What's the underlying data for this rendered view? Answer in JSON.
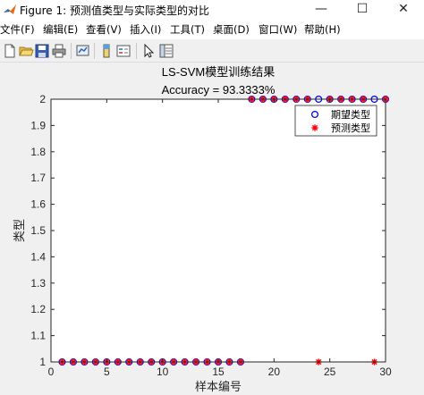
{
  "window": {
    "title": "Figure 1: 预测值类型与实际类型的对比",
    "minimize_glyph": "—",
    "maximize_glyph": "☐",
    "close_glyph": "✕"
  },
  "menu": {
    "items": [
      {
        "label": "文件(F)"
      },
      {
        "label": "编辑(E)"
      },
      {
        "label": "查看(V)"
      },
      {
        "label": "插入(I)"
      },
      {
        "label": "工具(T)"
      },
      {
        "label": "桌面(D)"
      },
      {
        "label": "窗口(W)"
      },
      {
        "label": "帮助(H)"
      }
    ]
  },
  "toolbar": {
    "icons": [
      "new-figure-icon",
      "open-file-icon",
      "save-icon",
      "print-icon",
      "link-plot-icon",
      "colorbar-icon",
      "legend-icon",
      "pointer-icon",
      "property-editor-icon"
    ]
  },
  "colors": {
    "expected_marker": "#0000ff",
    "predicted_marker": "#ff0000",
    "axes_background": "#ffffff",
    "figure_background": "#f0f0f0"
  },
  "chart_data": {
    "type": "scatter",
    "title": "LS-SVM模型训练结果",
    "subtitle": "Accuracy = 93.3333%",
    "xlabel": "样本编号",
    "ylabel": "类型",
    "xlim": [
      0,
      30
    ],
    "ylim": [
      1,
      2
    ],
    "xticks": [
      0,
      5,
      10,
      15,
      20,
      25,
      30
    ],
    "yticks": [
      1,
      1.1,
      1.2,
      1.3,
      1.4,
      1.5,
      1.6,
      1.7,
      1.8,
      1.9,
      2
    ],
    "grid": false,
    "legend_position": "top-right",
    "x": [
      1,
      2,
      3,
      4,
      5,
      6,
      7,
      8,
      9,
      10,
      11,
      12,
      13,
      14,
      15,
      16,
      17,
      18,
      19,
      20,
      21,
      22,
      23,
      24,
      25,
      26,
      27,
      28,
      29,
      30
    ],
    "series": [
      {
        "name": "期望类型",
        "marker": "circle",
        "values": [
          1,
          1,
          1,
          1,
          1,
          1,
          1,
          1,
          1,
          1,
          1,
          1,
          1,
          1,
          1,
          1,
          1,
          2,
          2,
          2,
          2,
          2,
          2,
          2,
          2,
          2,
          2,
          2,
          2,
          2
        ]
      },
      {
        "name": "预测类型",
        "marker": "star",
        "values": [
          1,
          1,
          1,
          1,
          1,
          1,
          1,
          1,
          1,
          1,
          1,
          1,
          1,
          1,
          1,
          1,
          1,
          2,
          2,
          2,
          2,
          2,
          2,
          1,
          2,
          2,
          2,
          2,
          1,
          2
        ]
      }
    ]
  }
}
